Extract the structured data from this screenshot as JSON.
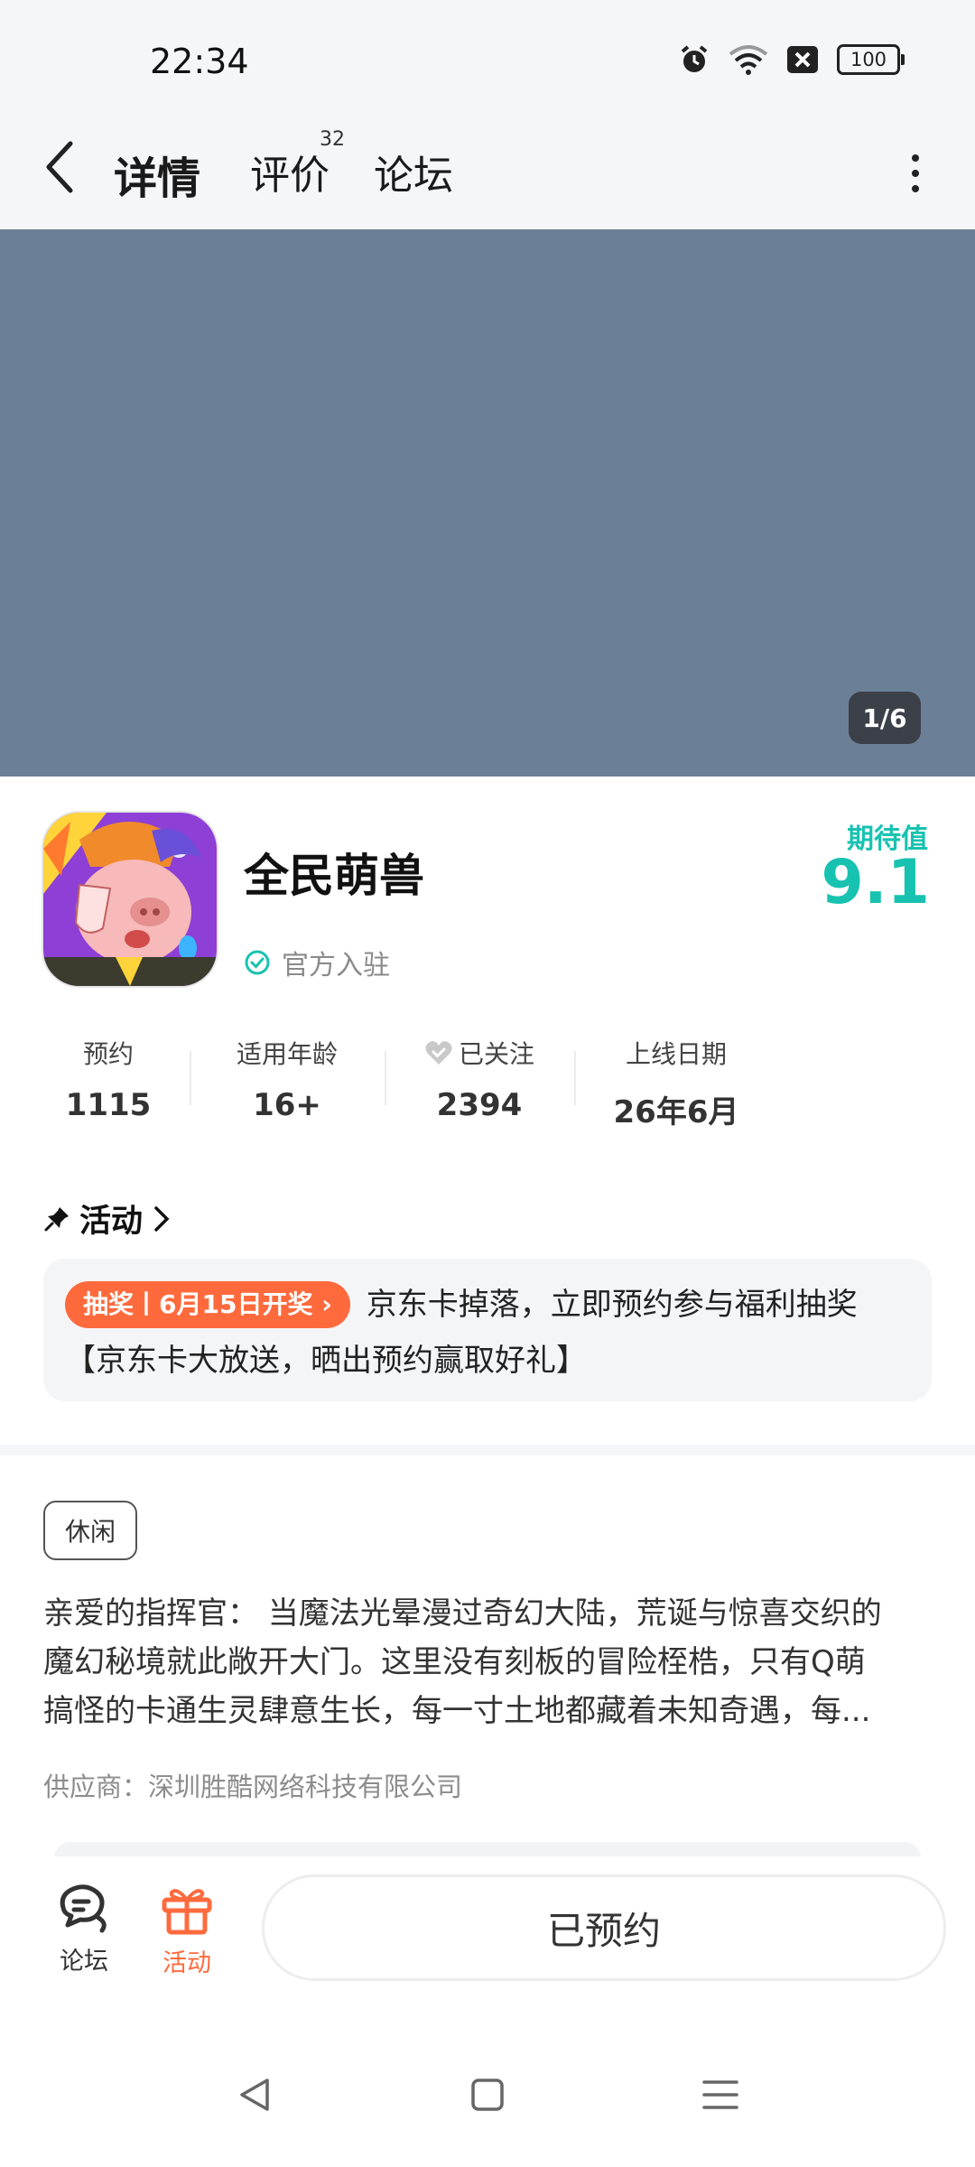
{
  "status_bar": {
    "time": "22:34",
    "battery": "100"
  },
  "nav": {
    "tabs": [
      {
        "label": "详情",
        "active": true
      },
      {
        "label": "评价",
        "badge": "32"
      },
      {
        "label": "论坛"
      }
    ]
  },
  "banner": {
    "counter": "1/6"
  },
  "app": {
    "name": "全民萌兽",
    "official_label": "官方入驻",
    "expect_label": "期待值",
    "expect_score": "9.1"
  },
  "stats": [
    {
      "label": "预约",
      "value": "1115"
    },
    {
      "label": "适用年龄",
      "value": "16+"
    },
    {
      "label": "已关注",
      "value": "2394"
    },
    {
      "label": "上线日期",
      "value": "26年6月"
    }
  ],
  "activity": {
    "heading": "活动",
    "tag": "抽奖丨6月15日开奖",
    "text": "京东卡掉落，立即预约参与福利抽奖【京东卡大放送，晒出预约赢取好礼】"
  },
  "description": {
    "tag": "休闲",
    "lines": [
      "亲爱的指挥官： 当魔法光晕漫过奇幻大陆，荒诞与惊喜交织的",
      "魔幻秘境就此敞开大门。这里没有刻板的冒险桎梏，只有Q萌",
      "搞怪的卡通生灵肆意生长，每一寸土地都藏着未知奇遇，每..."
    ],
    "supplier": "供应商：深圳胜酷网络科技有限公司"
  },
  "bottom_bar": {
    "forum_label": "论坛",
    "activity_label": "活动",
    "reserve_label": "已预约"
  },
  "colors": {
    "accent": "#18c2b0",
    "orange": "#ff6a3d",
    "banner": "#6b7f97"
  }
}
